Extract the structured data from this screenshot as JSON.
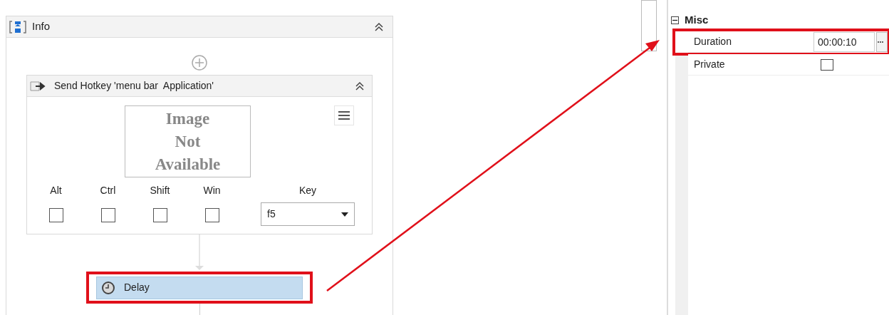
{
  "sequence": {
    "title": "Info",
    "activity": {
      "title": "Send Hotkey 'menu bar  Application'",
      "image_placeholder": [
        "Image",
        "Not",
        "Available"
      ],
      "modifiers": [
        {
          "label": "Alt",
          "checked": false
        },
        {
          "label": "Ctrl",
          "checked": false
        },
        {
          "label": "Shift",
          "checked": false
        },
        {
          "label": "Win",
          "checked": false
        }
      ],
      "key": {
        "label": "Key",
        "value": "f5"
      }
    },
    "next_activity": {
      "title": "Delay",
      "selected": true,
      "highlighted": true
    }
  },
  "properties": {
    "category": {
      "label": "Misc",
      "expanded": true
    },
    "rows": [
      {
        "kind": "text",
        "name": "Duration",
        "value": "00:00:10",
        "highlighted": true
      },
      {
        "kind": "checkbox",
        "name": "Private",
        "checked": false,
        "highlighted": false
      }
    ]
  }
}
